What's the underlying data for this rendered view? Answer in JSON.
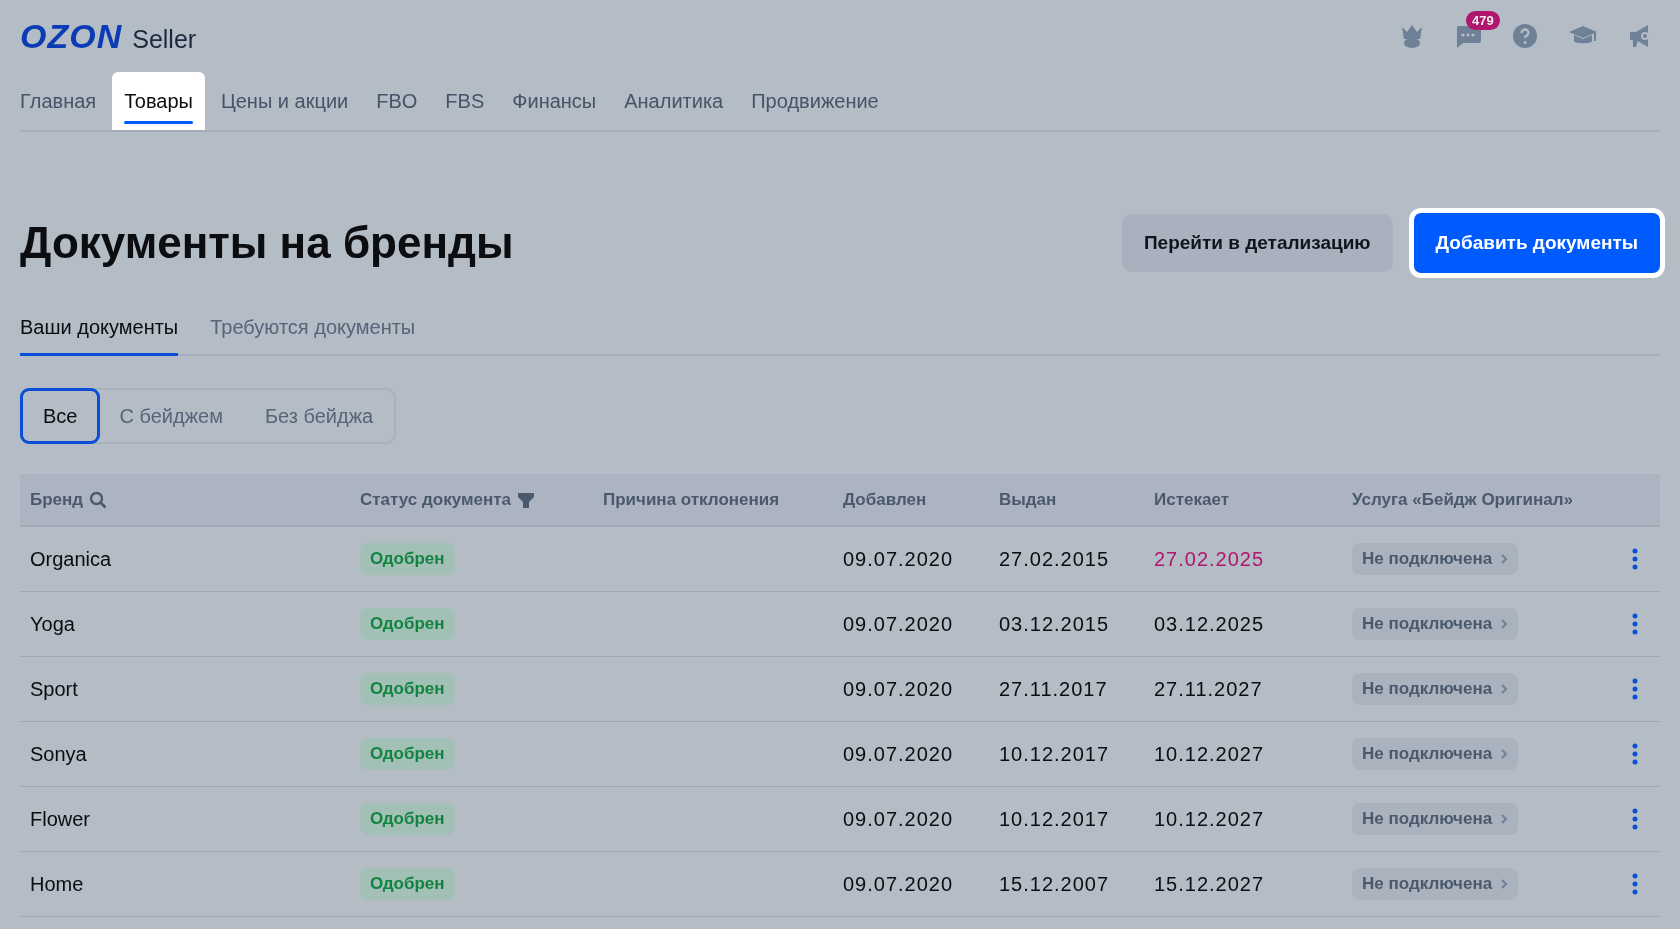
{
  "header": {
    "logo": "OZON",
    "product": "Seller",
    "notifications_badge": "479"
  },
  "nav": [
    {
      "label": "Главная",
      "selected": false
    },
    {
      "label": "Товары",
      "selected": true
    },
    {
      "label": "Цены и акции",
      "selected": false
    },
    {
      "label": "FBO",
      "selected": false
    },
    {
      "label": "FBS",
      "selected": false
    },
    {
      "label": "Финансы",
      "selected": false
    },
    {
      "label": "Аналитика",
      "selected": false
    },
    {
      "label": "Продвижение",
      "selected": false
    }
  ],
  "page": {
    "title": "Документы на бренды",
    "secondary_button": "Перейти в детализацию",
    "primary_button": "Добавить документы"
  },
  "tabs": [
    {
      "label": "Ваши документы",
      "selected": true
    },
    {
      "label": "Требуются документы",
      "selected": false
    }
  ],
  "filters": [
    {
      "label": "Все",
      "selected": true
    },
    {
      "label": "С бейджем",
      "selected": false
    },
    {
      "label": "Без бейджа",
      "selected": false
    }
  ],
  "table": {
    "columns": [
      {
        "label": "Бренд",
        "kind": "search"
      },
      {
        "label": "Статус документа",
        "kind": "filter"
      },
      {
        "label": "Причина отклонения",
        "kind": "plain"
      },
      {
        "label": "Добавлен",
        "kind": "plain"
      },
      {
        "label": "Выдан",
        "kind": "plain"
      },
      {
        "label": "Истекает",
        "kind": "plain"
      },
      {
        "label": "Услуга «Бейдж Оригинал»",
        "kind": "plain"
      }
    ],
    "rows": [
      {
        "brand": "Organica",
        "status": "Одобрен",
        "added": "09.07.2020",
        "issued": "27.02.2015",
        "expires": "27.02.2025",
        "expiring_soon": true,
        "service": "Не подключена"
      },
      {
        "brand": "Yoga",
        "status": "Одобрен",
        "added": "09.07.2020",
        "issued": "03.12.2015",
        "expires": "03.12.2025",
        "expiring_soon": false,
        "service": "Не подключена"
      },
      {
        "brand": "Sport",
        "status": "Одобрен",
        "added": "09.07.2020",
        "issued": "27.11.2017",
        "expires": "27.11.2027",
        "expiring_soon": false,
        "service": "Не подключена"
      },
      {
        "brand": "Sonya",
        "status": "Одобрен",
        "added": "09.07.2020",
        "issued": "10.12.2017",
        "expires": "10.12.2027",
        "expiring_soon": false,
        "service": "Не подключена"
      },
      {
        "brand": "Flower",
        "status": "Одобрен",
        "added": "09.07.2020",
        "issued": "10.12.2017",
        "expires": "10.12.2027",
        "expiring_soon": false,
        "service": "Не подключена"
      },
      {
        "brand": "Home",
        "status": "Одобрен",
        "added": "09.07.2020",
        "issued": "15.12.2007",
        "expires": "15.12.2027",
        "expiring_soon": false,
        "service": "Не подключена"
      }
    ]
  }
}
